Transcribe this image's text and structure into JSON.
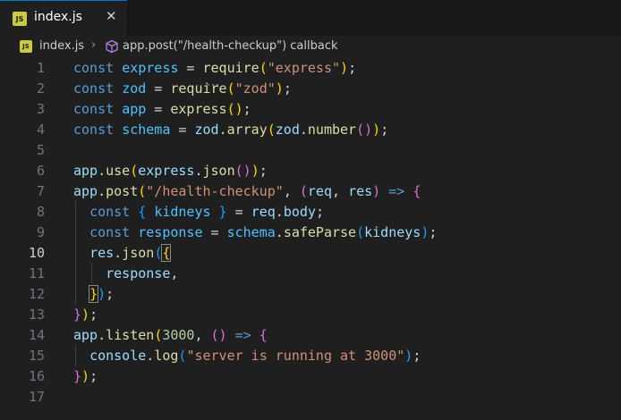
{
  "tab": {
    "icon": "js-file-icon",
    "icon_text": "JS",
    "label": "index.js",
    "close": "✕"
  },
  "breadcrumb": {
    "icon_text": "JS",
    "file": "index.js",
    "separator": "›",
    "symbol_icon": "method-cube-icon",
    "method": "app.post(\"/health-checkup\") callback"
  },
  "editor": {
    "current_line": "10",
    "lines": [
      {
        "n": "1",
        "t": [
          [
            "k",
            "const "
          ],
          [
            "c",
            "express"
          ],
          [
            "p",
            " = "
          ],
          [
            "f",
            "require"
          ],
          [
            "b1",
            "("
          ],
          [
            "s",
            "\"express\""
          ],
          [
            "b1",
            ")"
          ],
          [
            "p",
            ";"
          ]
        ]
      },
      {
        "n": "2",
        "t": [
          [
            "k",
            "const "
          ],
          [
            "c",
            "zod"
          ],
          [
            "p",
            " = "
          ],
          [
            "f",
            "require"
          ],
          [
            "b1",
            "("
          ],
          [
            "s",
            "\"zod\""
          ],
          [
            "b1",
            ")"
          ],
          [
            "p",
            ";"
          ]
        ]
      },
      {
        "n": "3",
        "t": [
          [
            "k",
            "const "
          ],
          [
            "c",
            "app"
          ],
          [
            "p",
            " = "
          ],
          [
            "f",
            "express"
          ],
          [
            "b1",
            "()"
          ],
          [
            "p",
            ";"
          ]
        ]
      },
      {
        "n": "4",
        "t": [
          [
            "k",
            "const "
          ],
          [
            "c",
            "schema"
          ],
          [
            "p",
            " = "
          ],
          [
            "v",
            "zod"
          ],
          [
            "p",
            "."
          ],
          [
            "f",
            "array"
          ],
          [
            "b1",
            "("
          ],
          [
            "v",
            "zod"
          ],
          [
            "p",
            "."
          ],
          [
            "f",
            "number"
          ],
          [
            "b2",
            "()"
          ],
          [
            "b1",
            ")"
          ],
          [
            "p",
            ";"
          ]
        ]
      },
      {
        "n": "5",
        "t": []
      },
      {
        "n": "6",
        "t": [
          [
            "v",
            "app"
          ],
          [
            "p",
            "."
          ],
          [
            "f",
            "use"
          ],
          [
            "b1",
            "("
          ],
          [
            "v",
            "express"
          ],
          [
            "p",
            "."
          ],
          [
            "f",
            "json"
          ],
          [
            "b2",
            "()"
          ],
          [
            "b1",
            ")"
          ],
          [
            "p",
            ";"
          ]
        ]
      },
      {
        "n": "7",
        "t": [
          [
            "v",
            "app"
          ],
          [
            "p",
            "."
          ],
          [
            "f",
            "post"
          ],
          [
            "b1",
            "("
          ],
          [
            "s",
            "\"/health-checkup\""
          ],
          [
            "p",
            ", "
          ],
          [
            "b2",
            "("
          ],
          [
            "v",
            "req"
          ],
          [
            "p",
            ", "
          ],
          [
            "v",
            "res"
          ],
          [
            "b2",
            ")"
          ],
          [
            "p",
            " "
          ],
          [
            "k",
            "=>"
          ],
          [
            "p",
            " "
          ],
          [
            "b2",
            "{"
          ]
        ]
      },
      {
        "n": "8",
        "t": [
          [
            "p",
            "  "
          ],
          [
            "k",
            "const "
          ],
          [
            "b3",
            "{ "
          ],
          [
            "c",
            "kidneys"
          ],
          [
            "b3",
            " }"
          ],
          [
            "p",
            " = "
          ],
          [
            "v",
            "req"
          ],
          [
            "p",
            "."
          ],
          [
            "v",
            "body"
          ],
          [
            "p",
            ";"
          ]
        ]
      },
      {
        "n": "9",
        "t": [
          [
            "p",
            "  "
          ],
          [
            "k",
            "const "
          ],
          [
            "c",
            "response"
          ],
          [
            "p",
            " = "
          ],
          [
            "c",
            "schema"
          ],
          [
            "p",
            "."
          ],
          [
            "f",
            "safeParse"
          ],
          [
            "b3",
            "("
          ],
          [
            "v",
            "kidneys"
          ],
          [
            "b3",
            ")"
          ],
          [
            "p",
            ";"
          ]
        ]
      },
      {
        "n": "10",
        "t": [
          [
            "p",
            "  "
          ],
          [
            "v",
            "res"
          ],
          [
            "p",
            "."
          ],
          [
            "f",
            "json"
          ],
          [
            "b3",
            "("
          ],
          [
            "b1m",
            "{"
          ]
        ]
      },
      {
        "n": "11",
        "t": [
          [
            "p",
            "    "
          ],
          [
            "v",
            "response"
          ],
          [
            "p",
            ","
          ]
        ]
      },
      {
        "n": "12",
        "t": [
          [
            "p",
            "  "
          ],
          [
            "b1m",
            "}"
          ],
          [
            "b3",
            ")"
          ],
          [
            "p",
            ";"
          ]
        ]
      },
      {
        "n": "13",
        "t": [
          [
            "b2",
            "}"
          ],
          [
            "b1",
            ")"
          ],
          [
            "p",
            ";"
          ]
        ]
      },
      {
        "n": "14",
        "t": [
          [
            "v",
            "app"
          ],
          [
            "p",
            "."
          ],
          [
            "f",
            "listen"
          ],
          [
            "b1",
            "("
          ],
          [
            "n",
            "3000"
          ],
          [
            "p",
            ", "
          ],
          [
            "b2",
            "()"
          ],
          [
            "p",
            " "
          ],
          [
            "k",
            "=>"
          ],
          [
            "p",
            " "
          ],
          [
            "b2",
            "{"
          ]
        ]
      },
      {
        "n": "15",
        "t": [
          [
            "p",
            "  "
          ],
          [
            "v",
            "console"
          ],
          [
            "p",
            "."
          ],
          [
            "f",
            "log"
          ],
          [
            "b3",
            "("
          ],
          [
            "s",
            "\"server is running at 3000\""
          ],
          [
            "b3",
            ")"
          ],
          [
            "p",
            ";"
          ]
        ]
      },
      {
        "n": "16",
        "t": [
          [
            "b2",
            "}"
          ],
          [
            "b1",
            ")"
          ],
          [
            "p",
            ";"
          ]
        ]
      },
      {
        "n": "17",
        "t": []
      }
    ]
  }
}
